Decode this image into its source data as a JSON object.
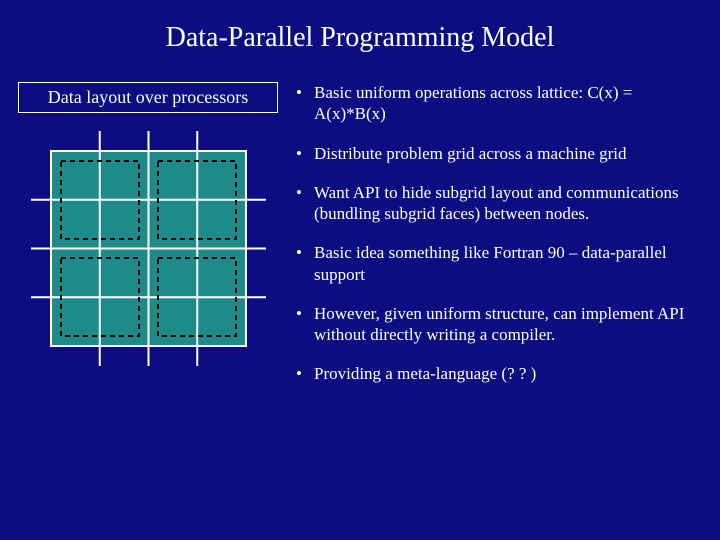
{
  "title": "Data-Parallel Programming Model",
  "left": {
    "caption": "Data layout over processors"
  },
  "bullets": [
    "Basic uniform operations across lattice: C(x) = A(x)*B(x)",
    "Distribute problem grid across a machine grid",
    "Want API to hide subgrid layout and communications (bundling subgrid faces) between nodes.",
    "Basic idea something like Fortran 90 – data-parallel support",
    "However, given uniform structure, can implement API without directly writing a compiler.",
    "Providing a meta-language (? ? )"
  ]
}
